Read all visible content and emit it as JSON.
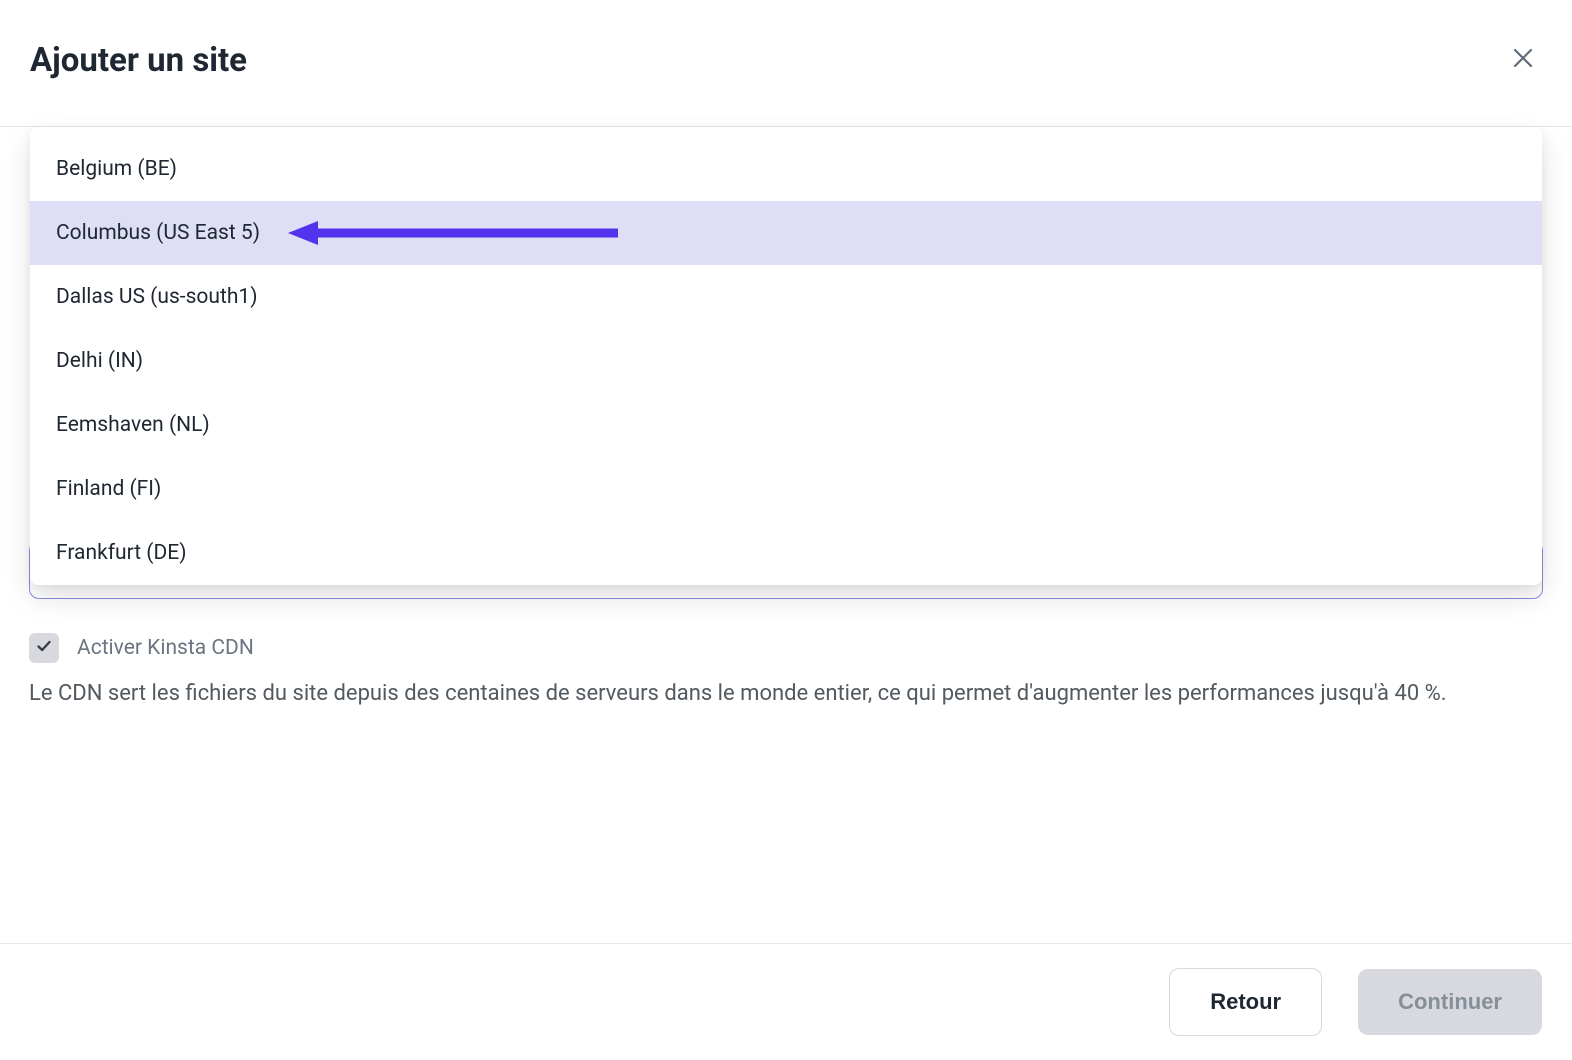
{
  "header": {
    "title": "Ajouter un site"
  },
  "dropdown": {
    "items": [
      {
        "label": "Belgium (BE)",
        "highlighted": false
      },
      {
        "label": "Columbus (US East 5)",
        "highlighted": true
      },
      {
        "label": "Dallas US (us-south1)",
        "highlighted": false
      },
      {
        "label": "Delhi (IN)",
        "highlighted": false
      },
      {
        "label": "Eemshaven (NL)",
        "highlighted": false
      },
      {
        "label": "Finland (FI)",
        "highlighted": false
      },
      {
        "label": "Frankfurt (DE)",
        "highlighted": false
      }
    ]
  },
  "select": {
    "value": ""
  },
  "cdn": {
    "label": "Activer Kinsta CDN",
    "description": "Le CDN sert les fichiers du site depuis des centaines de serveurs dans le monde entier, ce qui permet d'augmenter les performances jusqu'à 40 %.",
    "checked": true
  },
  "footer": {
    "back": "Retour",
    "continue": "Continuer"
  },
  "colors": {
    "accent": "#5333ed",
    "highlight_bg": "#dedef6"
  }
}
